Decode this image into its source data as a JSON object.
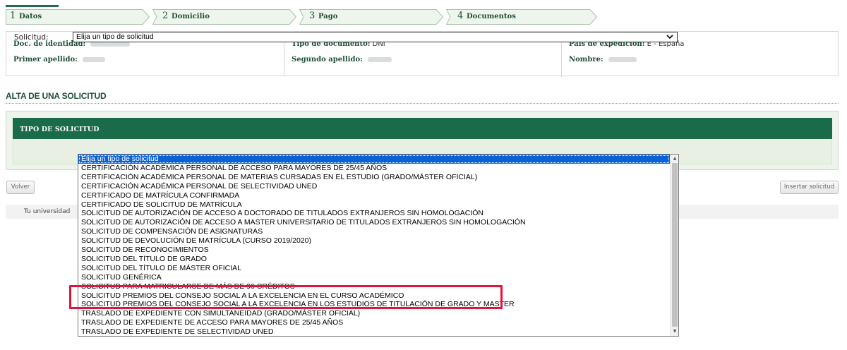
{
  "steps": [
    {
      "num": "1",
      "label": "Datos"
    },
    {
      "num": "2",
      "label": "Domicilio"
    },
    {
      "num": "3",
      "label": "Pago"
    },
    {
      "num": "4",
      "label": "Documentos"
    }
  ],
  "person": {
    "doc_identidad_label": "Doc. de identidad:",
    "primer_apellido_label": "Primer apellido:",
    "tipo_documento_label": "Tipo de documento:",
    "tipo_documento_value": "DNI",
    "segundo_apellido_label": "Segundo apellido:",
    "pais_label": "País de expedición:",
    "pais_value": "E - España",
    "nombre_label": "Nombre:"
  },
  "section_title": "ALTA DE UNA SOLICITUD",
  "panel": {
    "title": "TIPO DE SOLICITUD",
    "solicitud_label": "Solicitud:",
    "selected_value": "Elija un tipo de solicitud"
  },
  "buttons": {
    "back": "Volver",
    "insert": "Insertar solicitud"
  },
  "footer_text": "Tu universidad",
  "dropdown_options": [
    "Elija un tipo de solicitud",
    "CERTIFICACIÓN ACADÉMICA PERSONAL DE ACCESO PARA MAYORES DE 25/45 AÑOS",
    "CERTIFICACIÓN ACADÉMICA PERSONAL DE MATERIAS CURSADAS EN EL ESTUDIO (GRADO/MÁSTER OFICIAL)",
    "CERTIFICACIÓN ACADÉMICA PERSONAL DE SELECTIVIDAD UNED",
    "CERTIFICADO DE MATRÍCULA CONFIRMADA",
    "CERTIFICADO DE SOLICITUD DE MATRÍCULA",
    "SOLICITUD DE AUTORIZACIÓN DE ACCESO A DOCTORADO DE TITULADOS EXTRANJEROS SIN HOMOLOGACIÓN",
    "SOLICITUD DE AUTORIZACIÓN DE ACCESO A MASTER UNIVERSITARIO DE TITULADOS EXTRANJEROS SIN HOMOLOGACIÓN",
    "SOLICITUD DE COMPENSACIÓN DE ASIGNATURAS",
    "SOLICITUD DE DEVOLUCIÓN DE MATRÍCULA (CURSO 2019/2020)",
    "SOLICITUD DE RECONOCIMIENTOS",
    "SOLICITUD DEL TÍTULO DE GRADO",
    "SOLICITUD DEL TÍTULO DE MÁSTER OFICIAL",
    "SOLICITUD GENÉRICA",
    "SOLICITUD PARA MATRICULARSE DE MÁS DE 90 CRÉDITOS",
    "SOLICITUD PREMIOS DEL CONSEJO SOCIAL A LA EXCELENCIA EN EL CURSO ACADÉMICO",
    "SOLICITUD PREMIOS DEL CONSEJO SOCIAL A LA EXCELENCIA EN LOS ESTUDIOS DE TITULACIÓN DE GRADO Y MASTER",
    "TRASLADO DE EXPEDIENTE CON SIMULTANEIDAD (GRADO/MÁSTER OFICIAL)",
    "TRASLADO DE EXPEDIENTE DE ACCESO PARA MAYORES DE 25/45 AÑOS",
    "TRASLADO DE EXPEDIENTE DE SELECTIVIDAD UNED"
  ],
  "colors": {
    "brand_green": "#1a6b4a",
    "selection_blue": "#0a63d6",
    "highlight_red": "#e0143c"
  }
}
